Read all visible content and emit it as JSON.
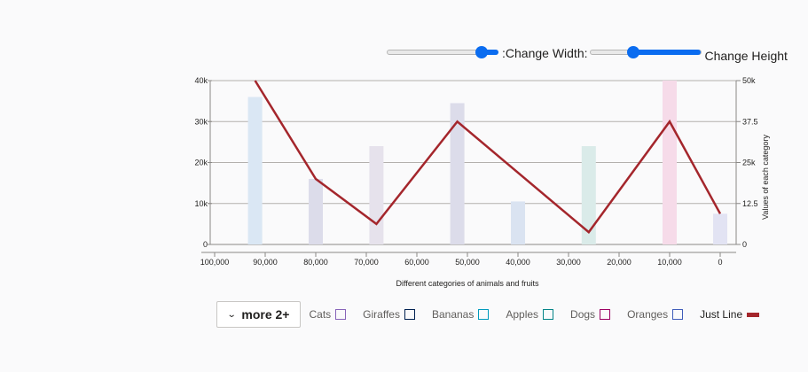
{
  "controls": {
    "width_label": ":Change Width:",
    "height_label": "Change Height",
    "width_value": 0.85,
    "height_value": 0.39
  },
  "legend": {
    "more_button": "more 2+",
    "items": [
      {
        "label": "Cats",
        "color": "#8764b8",
        "type": "bar"
      },
      {
        "label": "Giraffes",
        "color": "#002050",
        "type": "bar"
      },
      {
        "label": "Bananas",
        "color": "#0099bc",
        "type": "bar"
      },
      {
        "label": "Apples",
        "color": "#038387",
        "type": "bar"
      },
      {
        "label": "Dogs",
        "color": "#9b0062",
        "type": "bar"
      },
      {
        "label": "Oranges",
        "color": "#3f5cb9",
        "type": "bar"
      },
      {
        "label": "Just Line",
        "color": "#a4262c",
        "type": "line"
      }
    ]
  },
  "chart_data": {
    "type": "bar",
    "xlabel": "Different categories of animals and fruits",
    "ylabel": "",
    "y2label": "Values of each category",
    "xlim": [
      100000,
      0
    ],
    "ylim": [
      0,
      40000
    ],
    "y2lim": [
      0,
      50000
    ],
    "x_ticks": [
      "100,000",
      "90,000",
      "80,000",
      "70,000",
      "60,000",
      "50,000",
      "40,000",
      "30,000",
      "20,000",
      "10,000",
      "0"
    ],
    "y_ticks": [
      "0",
      "10k",
      "20k",
      "30k",
      "40k"
    ],
    "y2_ticks": [
      "0",
      "12.5",
      "25k",
      "37.5",
      "50k"
    ],
    "bars": [
      {
        "x": 92000,
        "value": 36000,
        "color": "#dae7f4"
      },
      {
        "x": 80000,
        "value": 16000,
        "color": "#dcdcea"
      },
      {
        "x": 68000,
        "value": 24000,
        "color": "#e6e2ec"
      },
      {
        "x": 52000,
        "value": 34500,
        "color": "#dcdcea"
      },
      {
        "x": 40000,
        "value": 10500,
        "color": "#dae3f1"
      },
      {
        "x": 26000,
        "value": 24000,
        "color": "#daebe9"
      },
      {
        "x": 10000,
        "value": 40000,
        "color": "#f6dbe9"
      },
      {
        "x": 0,
        "value": 7500,
        "color": "#e2e3f3"
      }
    ],
    "series": [
      {
        "name": "Just Line",
        "color": "#a4262c",
        "x": [
          92000,
          80000,
          68000,
          52000,
          26000,
          10000,
          0
        ],
        "y": [
          40000,
          16000,
          5000,
          30000,
          3000,
          30000,
          7500
        ]
      }
    ],
    "grid": true
  }
}
